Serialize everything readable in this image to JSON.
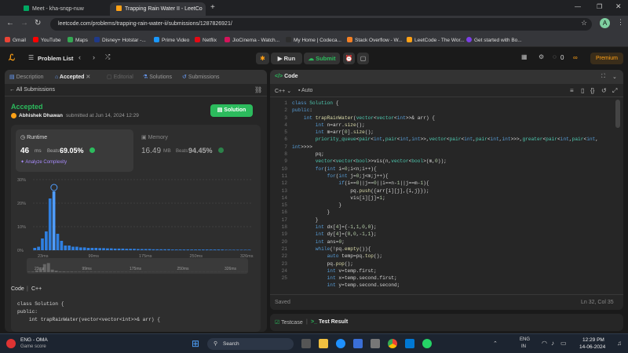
{
  "browser": {
    "tabs": [
      {
        "label": "Meet - kha-snqp-nuw",
        "active": false
      },
      {
        "label": "Trapping Rain Water II - LeetCo",
        "active": true
      }
    ],
    "url": "leetcode.com/problems/trapping-rain-water-ii/submissions/1287826921/",
    "bookmarks": [
      "Gmail",
      "YouTube",
      "Maps",
      "Disney+ Hotstar -...",
      "Prime Video",
      "Netflix",
      "JioCinema - Watch...",
      "My Home | Codeca...",
      "Stack Overflow - W...",
      "LeetCode - The Wor...",
      "Get started with Bo..."
    ],
    "profile_letter": "A"
  },
  "nav": {
    "problem_list": "Problem List",
    "run": "Run",
    "submit": "Submit",
    "streak": "0",
    "premium": "Premium"
  },
  "left": {
    "tabs": [
      "Description",
      "Accepted",
      "Editorial",
      "Solutions",
      "Submissions"
    ],
    "all_submissions": "All Submissions",
    "status": "Accepted",
    "user": "Abhishek Dhawan",
    "submitted": "submitted at Jun 14, 2024 12:29",
    "solution_btn": "Solution",
    "runtime_label": "Runtime",
    "runtime_value": "46",
    "runtime_unit": "ms",
    "beats_label": "Beats",
    "runtime_beats": "69.05%",
    "analyze": "Analyze Complexity",
    "memory_label": "Memory",
    "memory_value": "16.49",
    "memory_unit": "MB",
    "memory_beats": "94.45%",
    "code_label": "Code",
    "code_lang": "C++"
  },
  "chart_data": {
    "type": "bar",
    "ylabel_ticks": [
      "30%",
      "20%",
      "10%",
      "0%"
    ],
    "ylim": [
      0,
      30
    ],
    "xticks": [
      "23ms",
      "99ms",
      "175ms",
      "250ms",
      "326ms"
    ],
    "values": [
      1,
      1.5,
      5,
      8,
      22,
      25,
      7,
      4,
      2,
      2,
      1.5,
      1.5,
      1.2,
      1.2,
      1,
      1,
      1,
      0.9,
      0.9,
      0.8,
      0.8,
      0.7,
      0.7,
      0.7,
      0.6,
      0.6,
      0.6,
      0.5,
      0.5,
      0.5,
      0.5,
      0.4,
      0.4,
      0.4,
      0.4,
      0.4,
      0.3,
      0.3,
      0.3,
      0.3,
      0.3,
      0.3,
      0.3,
      0.3,
      0.3,
      0.3,
      0.3,
      0.3,
      0.3,
      0.3,
      0.2,
      0.2,
      0.2,
      0.2,
      0.2,
      0.2,
      0.2
    ],
    "highlight_index": 5
  },
  "code_panel": {
    "title": "Code",
    "lang": "C++",
    "mode": "Auto",
    "status": "Saved",
    "cursor": "Ln 32, Col 35",
    "lines": [
      "class Solution {",
      "public:",
      "    int trapRainWater(vector<vector<int>>& arr) {",
      "        int n=arr.size();",
      "        int m=arr[0].size();",
      "        priority_queue<pair<int,pair<int,int>>,vector<pair<int,pair<int,int>>>,greater<pair<int,pair<int,",
      "int>>>>",
      "        pq;",
      "        vector<vector<bool>>vis(n,vector<bool>(m,0));",
      "        for(int i=0;i<n;i++){",
      "            for(int j=0;j<m;j++){",
      "                if(i==0||j==0||i==n-1||j==m-1){",
      "                    pq.push({arr[i][j],{i,j}});",
      "                    vis[i][j]=1;",
      "                }",
      "            }",
      "        }",
      "        int dx[4]={-1,1,0,0};",
      "        int dy[4]={0,0,-1,1};",
      "        int ans=0;",
      "        while(!pq.empty()){",
      "            auto temp=pq.top();",
      "            pq.pop();",
      "            int v=temp.first;",
      "            int x=temp.second.first;",
      "            int y=temp.second.second;"
    ],
    "line_numbers": [
      "1",
      "2",
      "3",
      "4",
      "5",
      "6",
      "",
      "7",
      "8",
      "9",
      "10",
      "11",
      "12",
      "13",
      "14",
      "15",
      "16",
      "17",
      "18",
      "19",
      "20",
      "21",
      "22",
      "23",
      "24",
      "25"
    ],
    "bottom_tabs": [
      "Testcase",
      "Test Result"
    ]
  },
  "left_code_lines": [
    "class Solution {",
    "public:",
    "    int trapRainWater(vector<vector<int>>& arr) {"
  ],
  "taskbar": {
    "weather_label": "ENG - OMA",
    "weather_sub": "Game score",
    "search": "Search",
    "lang": "ENG",
    "region": "IN",
    "time": "12:29 PM",
    "date": "14-06-2024"
  }
}
